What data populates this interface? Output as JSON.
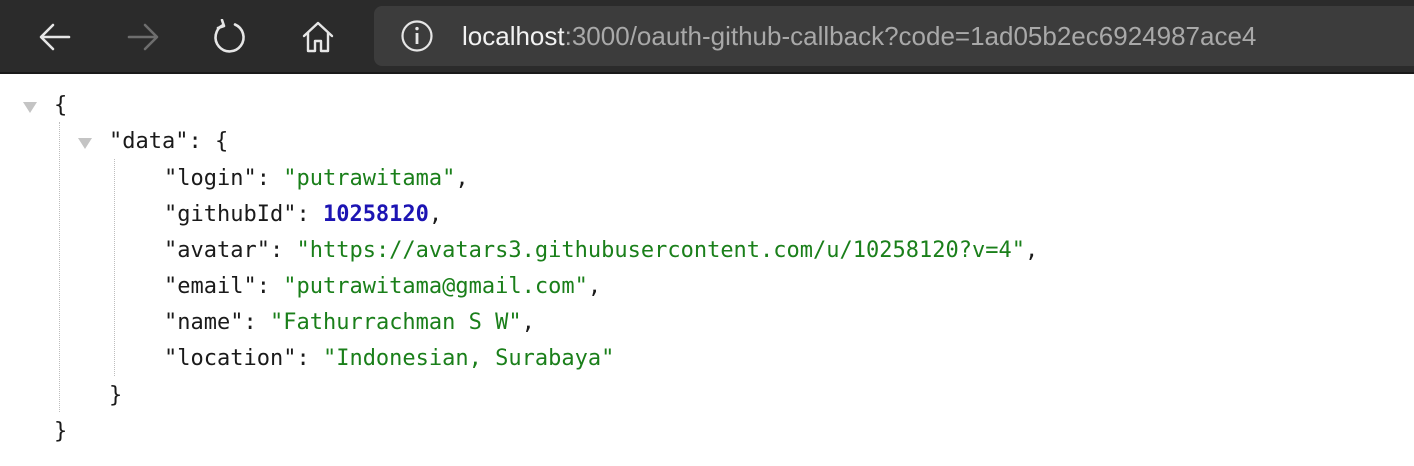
{
  "toolbar": {
    "icons": [
      "back-arrow-icon",
      "forward-arrow-icon",
      "reload-icon",
      "home-icon",
      "info-icon"
    ],
    "url_host": "localhost",
    "url_rest": ":3000/oauth-github-callback?code=1ad05b2ec6924987ace4"
  },
  "json": {
    "root_open": "{",
    "data_key": "\"data\"",
    "data_open": "{",
    "fields": [
      {
        "key": "\"login\"",
        "value": "\"putrawitama\"",
        "type": "string",
        "comma": ","
      },
      {
        "key": "\"githubId\"",
        "value": "10258120",
        "type": "number",
        "comma": ","
      },
      {
        "key": "\"avatar\"",
        "value": "\"https://avatars3.githubusercontent.com/u/10258120?v=4\"",
        "type": "string",
        "comma": ","
      },
      {
        "key": "\"email\"",
        "value": "\"putrawitama@gmail.com\"",
        "type": "string",
        "comma": ","
      },
      {
        "key": "\"name\"",
        "value": "\"Fathurrachman S W\"",
        "type": "string",
        "comma": ","
      },
      {
        "key": "\"location\"",
        "value": "\"Indonesian, Surabaya\"",
        "type": "string",
        "comma": ""
      }
    ],
    "data_close": "}",
    "root_close": "}"
  },
  "colors": {
    "string": "#1a7f1a",
    "number": "#1c14b3",
    "toolbar_bg": "#2b2b2b",
    "urlbar_bg": "#3c3c3c"
  }
}
